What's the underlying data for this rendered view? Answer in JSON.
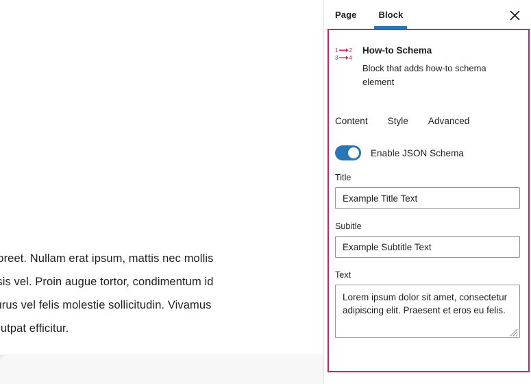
{
  "editor": {
    "document_paragraph": "pulvinar laoreet. Nullam erat ipsum, mattis nec mollis\neque facilisis vel. Proin augue tortor, condimentum id\nsectetur purus vel felis molestie sollicitudin. Vivamus\nibh non volutpat efficitur."
  },
  "sidebar": {
    "tabs": [
      {
        "label": "Page",
        "active": false
      },
      {
        "label": "Block",
        "active": true
      }
    ],
    "close_icon": "close-icon",
    "block": {
      "icon": "how-to-schema-icon",
      "title": "How-to Schema",
      "description": "Block that adds how-to schema element"
    },
    "inner_tabs": [
      {
        "label": "Content"
      },
      {
        "label": "Style"
      },
      {
        "label": "Advanced"
      }
    ],
    "toggle": {
      "label": "Enable JSON Schema",
      "state": "on"
    },
    "fields": {
      "title": {
        "label": "Title",
        "value": "Example Title Text",
        "placeholder": ""
      },
      "subtitle": {
        "label": "Subitle",
        "value": "Example Subtitle Text",
        "placeholder": ""
      },
      "text": {
        "label": "Text",
        "value": "Lorem ipsum dolor sit amet, consectetur adipiscing elit. Praesent et eros eu felis.",
        "placeholder": ""
      }
    }
  },
  "colors": {
    "highlight_border": "#e3175c",
    "accent_blue": "#2a75b3",
    "icon_pink": "#e3175c",
    "text": "#1e1e1e"
  }
}
